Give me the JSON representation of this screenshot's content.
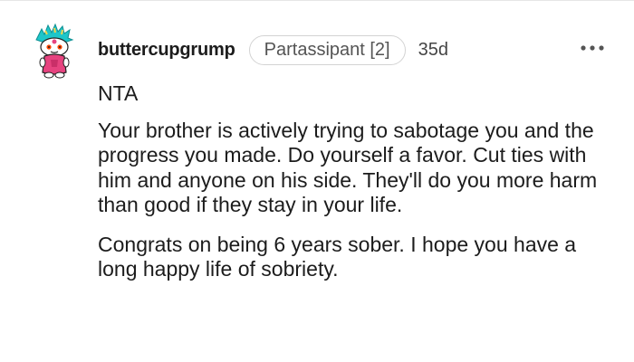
{
  "comment": {
    "username": "buttercupgrump",
    "flair": "Partassipant [2]",
    "timestamp": "35d",
    "more_icon": "more-horizontal-icon",
    "avatar_icon": "snoo-avatar-icon",
    "paragraphs": [
      "NTA",
      "Your brother is actively trying to sabotage you and the progress you made. Do yourself a favor. Cut ties with him and anyone on his side. They'll do you more harm than good if they stay in your life.",
      "Congrats on being 6 years sober. I hope you have a long happy life of sobriety."
    ]
  },
  "colors": {
    "text": "#1c1c1c",
    "flair_border": "#d3d3d3",
    "flair_text": "#545454",
    "avatar_teal": "#1ec6c9",
    "avatar_pink": "#e6437f"
  }
}
